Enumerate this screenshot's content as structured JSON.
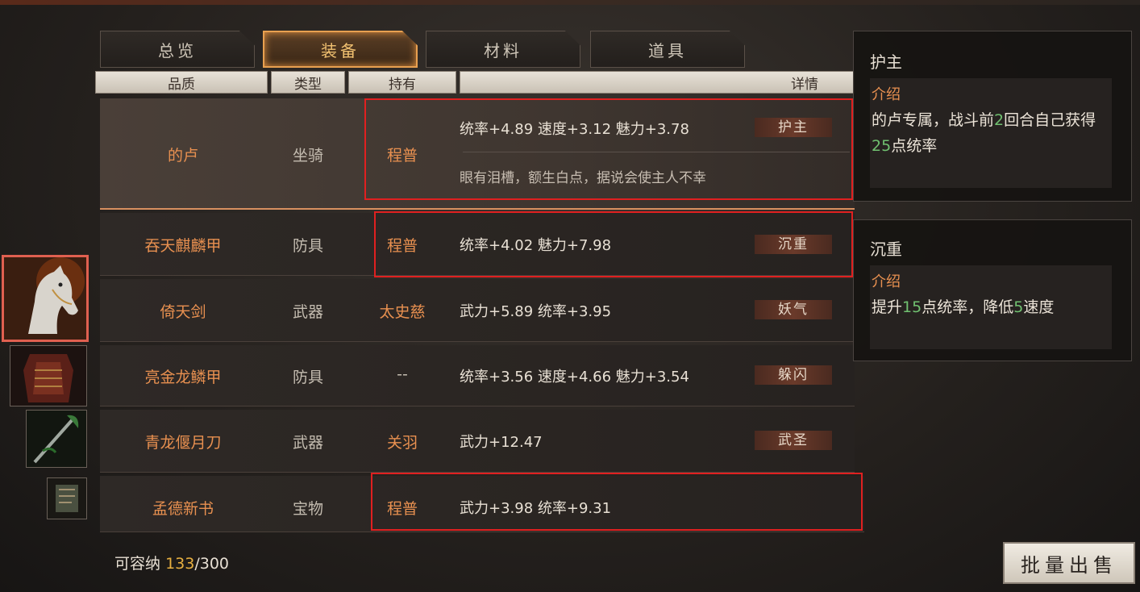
{
  "tabs": [
    {
      "label": "总览",
      "active": false
    },
    {
      "label": "装备",
      "active": true
    },
    {
      "label": "材料",
      "active": false
    },
    {
      "label": "道具",
      "active": false
    }
  ],
  "headers": {
    "quality": "品质",
    "type": "类型",
    "owner": "持有",
    "detail": "详情"
  },
  "items": [
    {
      "name": "的卢",
      "type": "坐骑",
      "owner": "程普",
      "stats": "统率+4.89  速度+3.12  魅力+3.78",
      "skill": "护主",
      "desc": "眼有泪槽，额生白点，据说会使主人不幸"
    },
    {
      "name": "吞天麒麟甲",
      "type": "防具",
      "owner": "程普",
      "stats": "统率+4.02  魅力+7.98",
      "skill": "沉重"
    },
    {
      "name": "倚天剑",
      "type": "武器",
      "owner": "太史慈",
      "stats": "武力+5.89  统率+3.95",
      "skill": "妖气"
    },
    {
      "name": "亮金龙鳞甲",
      "type": "防具",
      "owner": "--",
      "stats": "统率+3.56  速度+4.66  魅力+3.54",
      "skill": "躲闪"
    },
    {
      "name": "青龙偃月刀",
      "type": "武器",
      "owner": "关羽",
      "stats": "武力+12.47",
      "skill": "武圣"
    },
    {
      "name": "孟德新书",
      "type": "宝物",
      "owner": "程普",
      "stats": "武力+3.98  统率+9.31",
      "skill": ""
    }
  ],
  "popups": [
    {
      "title": "护主",
      "label": "介绍",
      "text_parts": [
        "的卢专属，战斗前",
        "2",
        "回合自己获得",
        "25",
        "点统率"
      ]
    },
    {
      "title": "沉重",
      "label": "介绍",
      "text_parts": [
        "提升",
        "15",
        "点统率，降低",
        "5",
        "速度"
      ]
    }
  ],
  "capacity": {
    "label": "可容纳",
    "current": "133",
    "separator": "/",
    "max": "300"
  },
  "sell_button": "批量出售",
  "colors": {
    "accent": "#e89050",
    "highlight_box": "#e02020",
    "green_number": "#70c070"
  }
}
